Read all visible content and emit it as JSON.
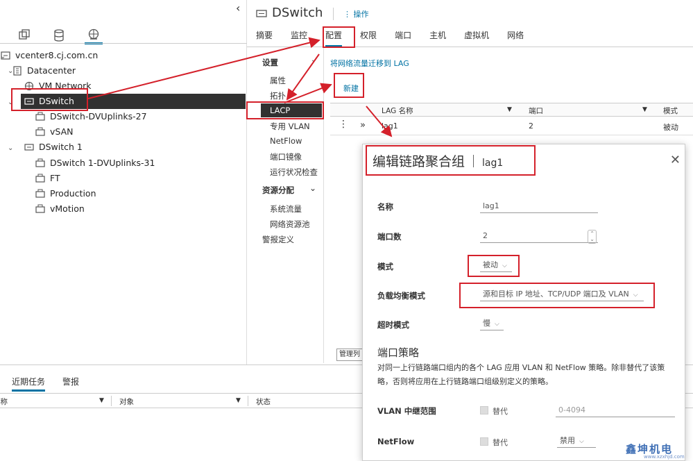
{
  "colors": {
    "accent": "#0072a3",
    "selected_bg": "#313131",
    "annotation_red": "#d4202a"
  },
  "left": {
    "tree_tab_icons": [
      "hosts-clusters-icon",
      "vms-templates-icon",
      "storage-icon",
      "networking-icon"
    ],
    "tree": {
      "vcenter": "vcenter8.cj.com.cn",
      "datacenter": "Datacenter",
      "vm_network": "VM Network",
      "dswitch": "DSwitch",
      "dswitch_uplinks": "DSwitch-DVUplinks-27",
      "vsan": "vSAN",
      "dswitch1": "DSwitch 1",
      "dswitch1_uplinks": "DSwitch 1-DVUplinks-31",
      "ft": "FT",
      "production": "Production",
      "vmotion": "vMotion"
    }
  },
  "header": {
    "title": "DSwitch",
    "actions": "操作"
  },
  "tabs": [
    "摘要",
    "监控",
    "配置",
    "权限",
    "端口",
    "主机",
    "虚拟机",
    "网络"
  ],
  "config_menu": {
    "settings": "设置",
    "properties": "属性",
    "topology": "拓扑",
    "lacp": "LACP",
    "private_vlan": "专用 VLAN",
    "netflow": "NetFlow",
    "port_mirroring": "端口镜像",
    "health_check": "运行状况检查",
    "resource_allocation": "资源分配",
    "system_traffic": "系统流量",
    "network_resource_pools": "网络资源池",
    "alarm_definitions": "警报定义"
  },
  "content": {
    "migrate_link": "将网络流量迁移到 LAG",
    "new_button": "新建",
    "columns": [
      "LAG 名称",
      "端口",
      "模式"
    ],
    "row": {
      "name": "lag1",
      "ports": "2",
      "mode": "被动"
    },
    "manage_columns": "管理列"
  },
  "bottom": {
    "tabs": [
      "近期任务",
      "警报"
    ],
    "columns": [
      "名称",
      "对象",
      "状态"
    ]
  },
  "dialog": {
    "title": "编辑链路聚合组",
    "subtitle": "lag1",
    "name_label": "名称",
    "name_value": "lag1",
    "ports_label": "端口数",
    "ports_value": "2",
    "mode_label": "模式",
    "mode_value": "被动",
    "lb_label": "负载均衡模式",
    "lb_value": "源和目标 IP 地址、TCP/UDP 端口及 VLAN",
    "timeout_label": "超时模式",
    "timeout_value": "慢",
    "policy_heading": "端口策略",
    "policy_desc": "对同一上行链路端口组内的各个 LAG 应用 VLAN 和 NetFlow 策略。除非替代了该策略，否则将应用在上行链路端口组级别定义的策略。",
    "vlan_label": "VLAN 中继范围",
    "override_label": "替代",
    "vlan_placeholder": "0-4094",
    "netflow_label": "NetFlow",
    "netflow_value": "禁用"
  },
  "watermark": {
    "text": "鑫坤机电",
    "sub": "www.xzxhjd.com"
  }
}
